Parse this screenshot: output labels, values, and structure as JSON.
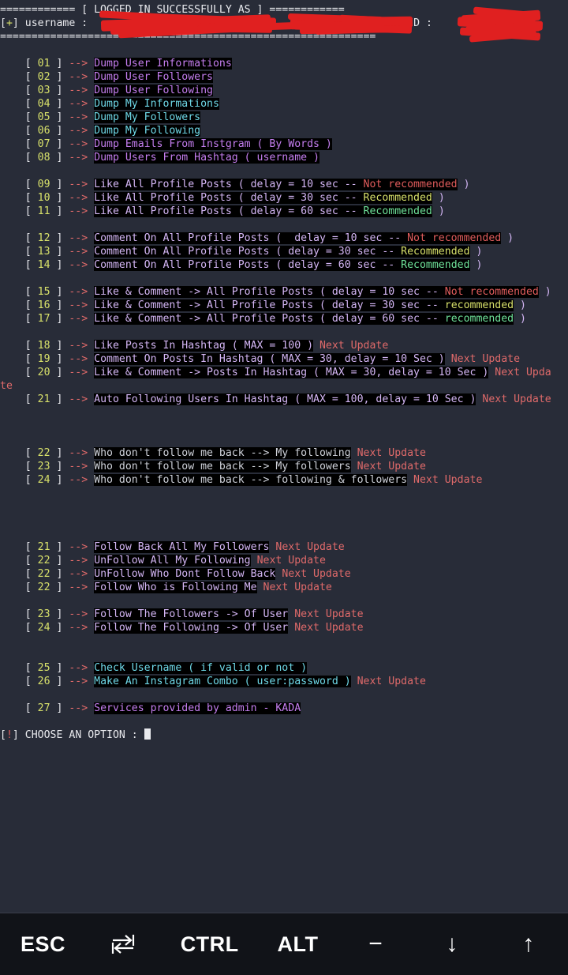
{
  "terminal": {
    "header": {
      "rule_top": "============ [ LOGGED IN SUCCESSFULLY AS ] ============",
      "status_bracket_open": "[",
      "status_plus": "+",
      "status_bracket_close": "]",
      "status_label": " username : ",
      "username_redacted": "",
      "as_word": "AS",
      "fullname_redacted": "",
      "arrow": ">>",
      "id_label": "ID :",
      "id_redacted": "",
      "rule_bottom": "============================================================"
    },
    "menu": [
      {
        "num": "01",
        "arrow": "-->",
        "text": "Dump User Informations",
        "color": "c-purple",
        "suffix": "",
        "suffix_color": ""
      },
      {
        "num": "02",
        "arrow": "-->",
        "text": "Dump User Followers",
        "color": "c-purple",
        "suffix": "",
        "suffix_color": ""
      },
      {
        "num": "03",
        "arrow": "-->",
        "text": "Dump User Following",
        "color": "c-purple",
        "suffix": "",
        "suffix_color": ""
      },
      {
        "num": "04",
        "arrow": "-->",
        "text": "Dump My Informations",
        "color": "c-cyan",
        "suffix": "",
        "suffix_color": ""
      },
      {
        "num": "05",
        "arrow": "-->",
        "text": "Dump My Followers",
        "color": "c-cyan",
        "suffix": "",
        "suffix_color": ""
      },
      {
        "num": "06",
        "arrow": "-->",
        "text": "Dump My Following",
        "color": "c-cyan",
        "suffix": "",
        "suffix_color": ""
      },
      {
        "num": "07",
        "arrow": "-->",
        "text": "Dump Emails From Instgram ( By Words )",
        "color": "c-purple",
        "suffix": "",
        "suffix_color": ""
      },
      {
        "num": "08",
        "arrow": "-->",
        "text": "Dump Users From Hashtag ( username )",
        "color": "c-purple",
        "suffix": "",
        "suffix_color": ""
      },
      {
        "spacer": true
      },
      {
        "num": "09",
        "arrow": "-->",
        "pre": "Like All Profile Posts ( delay = 10 sec -- ",
        "tag": "Not recommended",
        "tag_color": "c-red",
        "post": " )",
        "color": "c-lav"
      },
      {
        "num": "10",
        "arrow": "-->",
        "pre": "Like All Profile Posts ( delay = 30 sec -- ",
        "tag": "Recommended",
        "tag_color": "c-yellow",
        "post": " )",
        "color": "c-lav"
      },
      {
        "num": "11",
        "arrow": "-->",
        "pre": "Like All Profile Posts ( delay = 60 sec -- ",
        "tag": "Recommended",
        "tag_color": "c-green",
        "post": " )",
        "color": "c-lav"
      },
      {
        "spacer": true
      },
      {
        "num": "12",
        "arrow": "-->",
        "pre": "Comment On All Profile Posts (  delay = 10 sec -- ",
        "tag": "Not recommended",
        "tag_color": "c-red",
        "post": " )",
        "color": "c-lav"
      },
      {
        "num": "13",
        "arrow": "-->",
        "pre": "Comment On All Profile Posts ( delay = 30 sec -- ",
        "tag": "Recommended",
        "tag_color": "c-yellow",
        "post": " )",
        "color": "c-lav"
      },
      {
        "num": "14",
        "arrow": "-->",
        "pre": "Comment On All Profile Posts ( delay = 60 sec -- ",
        "tag": "Recommended",
        "tag_color": "c-green",
        "post": " )",
        "color": "c-lav"
      },
      {
        "spacer": true
      },
      {
        "num": "15",
        "arrow": "-->",
        "pre": "Like & Comment -> All Profile Posts ( delay = 10 sec -- ",
        "tag": "Not recommended",
        "tag_color": "c-red",
        "post": " )",
        "color": "c-lav"
      },
      {
        "num": "16",
        "arrow": "-->",
        "pre": "Like & Comment -> All Profile Posts ( delay = 30 sec -- ",
        "tag": "recommended",
        "tag_color": "c-yellow",
        "post": " )",
        "color": "c-lav"
      },
      {
        "num": "17",
        "arrow": "-->",
        "pre": "Like & Comment -> All Profile Posts ( delay = 60 sec -- ",
        "tag": "recommended",
        "tag_color": "c-green",
        "post": " )",
        "color": "c-lav"
      },
      {
        "spacer": true
      },
      {
        "num": "18",
        "arrow": "-->",
        "text": "Like Posts In Hashtag ( MAX = 100 )",
        "color": "c-lav",
        "suffix": " Next Update",
        "suffix_color": "c-salmon"
      },
      {
        "num": "19",
        "arrow": "-->",
        "text": "Comment On Posts In Hashtag ( MAX = 30, delay = 10 Sec )",
        "color": "c-lav",
        "suffix": " Next Update",
        "suffix_color": "c-salmon"
      },
      {
        "num": "20",
        "arrow": "-->",
        "text": "Like & Comment -> Posts In Hashtag ( MAX = 30, delay = 10 Sec )",
        "color": "c-lav",
        "suffix": " Next Upda",
        "suffix_color": "c-salmon",
        "wrap": "te",
        "wrap_color": "c-salmon"
      },
      {
        "num": "21",
        "arrow": "-->",
        "text": "Auto Following Users In Hashtag ( MAX = 100, delay = 10 Sec )",
        "color": "c-lav",
        "suffix": " Next Update",
        "suffix_color": "c-salmon"
      },
      {
        "spacer": true
      },
      {
        "spacer": true
      },
      {
        "spacer": true
      },
      {
        "num": "22",
        "arrow": "-->",
        "text": "Who don't follow me back --> My following",
        "color": "c-grey",
        "suffix": " Next Update",
        "suffix_color": "c-salmon"
      },
      {
        "num": "23",
        "arrow": "-->",
        "text": "Who don't follow me back --> My followers",
        "color": "c-grey",
        "suffix": " Next Update",
        "suffix_color": "c-salmon"
      },
      {
        "num": "24",
        "arrow": "-->",
        "text": "Who don't follow me back --> following & followers",
        "color": "c-grey",
        "suffix": " Next Update",
        "suffix_color": "c-salmon"
      },
      {
        "spacer": true
      },
      {
        "spacer": true
      },
      {
        "spacer": true
      },
      {
        "spacer": true
      },
      {
        "num": "21",
        "arrow": "-->",
        "text": "Follow Back All My Followers",
        "color": "c-lav",
        "suffix": " Next Update",
        "suffix_color": "c-salmon"
      },
      {
        "num": "22",
        "arrow": "-->",
        "text": "UnFollow All My Following",
        "color": "c-lav",
        "suffix": " Next Update",
        "suffix_color": "c-salmon"
      },
      {
        "num": "22",
        "arrow": "-->",
        "text": "UnFollow Who Dont Follow Back",
        "color": "c-lav",
        "suffix": " Next Update",
        "suffix_color": "c-salmon"
      },
      {
        "num": "22",
        "arrow": "-->",
        "text": "Follow Who is Following Me",
        "color": "c-lav",
        "suffix": " Next Update",
        "suffix_color": "c-salmon"
      },
      {
        "spacer": true
      },
      {
        "num": "23",
        "arrow": "-->",
        "text": "Follow The Followers -> Of User",
        "color": "c-lav",
        "suffix": " Next Update",
        "suffix_color": "c-salmon"
      },
      {
        "num": "24",
        "arrow": "-->",
        "text": "Follow The Following -> Of User",
        "color": "c-lav",
        "suffix": " Next Update",
        "suffix_color": "c-salmon"
      },
      {
        "spacer": true
      },
      {
        "spacer": true
      },
      {
        "num": "25",
        "arrow": "-->",
        "text": "Check Username ( if valid or not )",
        "color": "c-cyan",
        "suffix": "",
        "suffix_color": ""
      },
      {
        "num": "26",
        "arrow": "-->",
        "text": "Make An Instagram Combo ( user:password )",
        "color": "c-cyan",
        "suffix": " Next Update",
        "suffix_color": "c-salmon"
      },
      {
        "spacer": true
      },
      {
        "num": "27",
        "arrow": "-->",
        "text": "Services provided by admin - KADA",
        "color": "c-purple",
        "suffix": "",
        "suffix_color": ""
      }
    ],
    "prompt": {
      "bracket_open": "[",
      "bang": "!",
      "bracket_close": "]",
      "label": " CHOOSE AN OPTION : ",
      "input_value": ""
    }
  },
  "keybar": {
    "keys": [
      {
        "label": "ESC",
        "icon": "esc-key"
      },
      {
        "label": "",
        "icon": "tab-key-icon"
      },
      {
        "label": "CTRL",
        "icon": "ctrl-key"
      },
      {
        "label": "ALT",
        "icon": "alt-key"
      },
      {
        "label": "−",
        "icon": "minus-key"
      },
      {
        "label": "↓",
        "icon": "arrow-down-icon"
      },
      {
        "label": "↑",
        "icon": "arrow-up-icon"
      }
    ]
  },
  "colors": {
    "background": "#282c38",
    "highlight_bg": "#000000",
    "keybar_bg": "#111318",
    "redaction": "#e02020",
    "accent_yellow": "#d7e06a",
    "accent_green": "#6fe39a",
    "accent_red": "#e05c5c",
    "accent_purple": "#c57ef0",
    "accent_cyan": "#6fd9e8",
    "accent_lavender": "#d4b6f5"
  }
}
